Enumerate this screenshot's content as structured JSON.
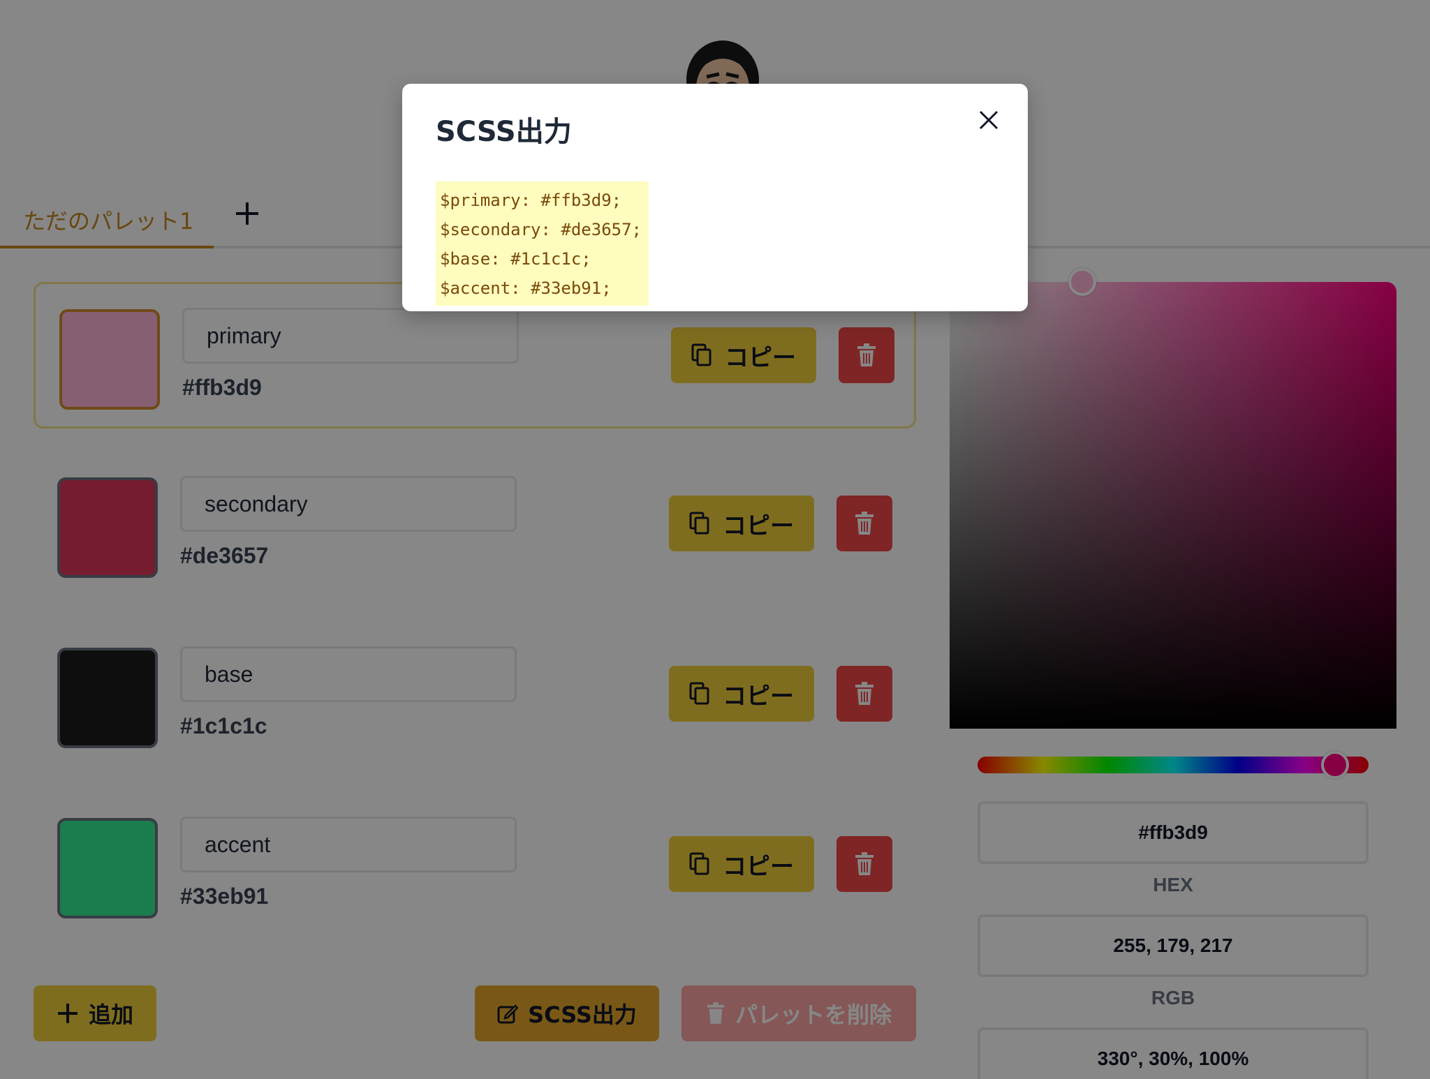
{
  "tabs": [
    {
      "label": "ただのパレット1",
      "active": true
    }
  ],
  "palette": {
    "copy_label": "コピー",
    "items": [
      {
        "name": "primary",
        "hex": "#ffb3d9",
        "swatch": "#ffb3d9",
        "selected": true
      },
      {
        "name": "secondary",
        "hex": "#de3657",
        "swatch": "#de3657",
        "selected": false
      },
      {
        "name": "base",
        "hex": "#1c1c1c",
        "swatch": "#1c1c1c",
        "selected": false
      },
      {
        "name": "accent",
        "hex": "#33eb91",
        "swatch": "#33eb91",
        "selected": false
      }
    ]
  },
  "actions": {
    "add_label": "追加",
    "scss_label": "SCSS出力",
    "delete_palette_label": "パレットを削除"
  },
  "picker": {
    "hex_value": "#ffb3d9",
    "hex_label": "HEX",
    "rgb_value": "255, 179, 217",
    "rgb_label": "RGB",
    "hsv_value": "330°, 30%, 100%"
  },
  "modal": {
    "title": "SCSS出力",
    "lines": [
      "$primary: #ffb3d9;",
      "$secondary: #de3657;",
      "$base: #1c1c1c;",
      "$accent: #33eb91;"
    ]
  },
  "colors": {
    "accent_yellow": "#f0ce3c",
    "accent_orange": "#e5a62c",
    "danger": "#f04646",
    "tab_active": "#c4871f"
  }
}
